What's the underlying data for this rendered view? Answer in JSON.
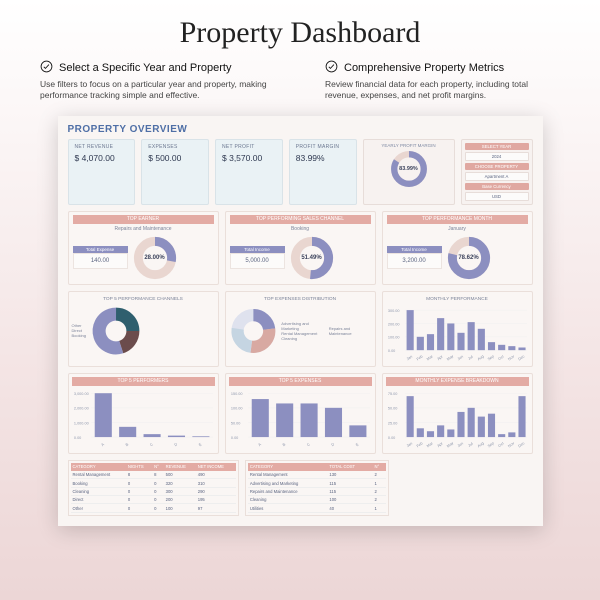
{
  "page": {
    "title": "Property Dashboard"
  },
  "features": [
    {
      "title": "Select a Specific Year and Property",
      "body": "Use filters to focus on a particular year and property, making performance tracking simple and effective."
    },
    {
      "title": "Comprehensive Property Metrics",
      "body": "Review financial data for each property, including total revenue, expenses, and net profit margins."
    }
  ],
  "dash": {
    "title": "PROPERTY OVERVIEW",
    "kpi": {
      "net_revenue": {
        "label": "NET REVENUE",
        "value": "$ 4,070.00"
      },
      "expenses": {
        "label": "EXPENSES",
        "value": "$ 500.00"
      },
      "net_profit": {
        "label": "NET PROFIT",
        "value": "$ 3,570.00"
      },
      "margin": {
        "label": "PROFIT MARGIN",
        "value": "83.99%"
      }
    },
    "gauge": {
      "header": "YEARLY PROFIT MARGIN",
      "pct": 83.99,
      "pct_text": "83.99%"
    },
    "filters": {
      "year": {
        "label": "SELECT YEAR",
        "value": "2024"
      },
      "property": {
        "label": "CHOOSE PROPERTY",
        "value": "Apartment A"
      },
      "currency": {
        "label": "Base Currency",
        "value": "USD"
      }
    },
    "highlight": {
      "top_earner": {
        "band": "TOP EARNER",
        "sub": "Repairs and Maintenance",
        "stat_label": "Total Expense",
        "stat_value": "140.00",
        "pct": 28.0,
        "pct_text": "28.00%"
      },
      "top_channel": {
        "band": "TOP PERFORMING SALES CHANNEL",
        "sub": "Booking",
        "stat_label": "Total Income",
        "stat_value": "5,000.00",
        "pct": 51.49,
        "pct_text": "51.49%"
      },
      "top_month": {
        "band": "TOP PERFORMANCE MONTH",
        "sub": "January",
        "stat_label": "Total Income",
        "stat_value": "3,200.00",
        "pct": 78.62,
        "pct_text": "78.62%"
      }
    },
    "labels": {
      "top5ch": "TOP 5 PERFORMANCE CHANNELS",
      "topexp": "TOP EXPENSES DISTRIBUTION",
      "monperf": "MONTHLY PERFORMANCE",
      "top5perf": "TOP 5 PERFORMERS",
      "top5exp": "TOP 5 EXPENSES",
      "monexp": "MONTHLY EXPENSE BREAKDOWN",
      "table1": [
        "CATEGORY",
        "NIGHTS",
        "N°",
        "REVENUE",
        "NET INCOME"
      ],
      "table2": [
        "CATEGORY",
        "TOTAL COST",
        "N°"
      ]
    }
  },
  "chart_data": [
    {
      "id": "yearly_gauge",
      "type": "pie",
      "title": "YEARLY PROFIT MARGIN",
      "values": [
        83.99,
        16.01
      ],
      "labels": [
        "Profit",
        "Remainder"
      ]
    },
    {
      "id": "top_earner",
      "type": "pie",
      "title": "TOP EARNER — Repairs and Maintenance",
      "values": [
        28.0,
        72.0
      ]
    },
    {
      "id": "top_channel",
      "type": "pie",
      "title": "TOP PERFORMING SALES CHANNEL — Booking",
      "values": [
        51.49,
        48.51
      ]
    },
    {
      "id": "top_month",
      "type": "pie",
      "title": "TOP PERFORMANCE MONTH — January",
      "values": [
        78.62,
        21.38
      ]
    },
    {
      "id": "top5_channels_donut",
      "type": "pie",
      "title": "TOP 5 PERFORMANCE CHANNELS",
      "labels": [
        "Other",
        "Direct",
        "Booking"
      ],
      "values": [
        25,
        20,
        55
      ]
    },
    {
      "id": "top_expenses_donut",
      "type": "pie",
      "title": "TOP EXPENSES DISTRIBUTION",
      "labels": [
        "Advertising and Marketing",
        "Repairs and Maintenance",
        "Rental Management",
        "Cleaning"
      ],
      "values": [
        23,
        29,
        25,
        23
      ]
    },
    {
      "id": "monthly_perf_bar",
      "type": "bar",
      "title": "MONTHLY PERFORMANCE",
      "categories": [
        "Jan",
        "Feb",
        "Mar",
        "Apr",
        "May",
        "Jun",
        "Jul",
        "Aug",
        "Sep",
        "Oct",
        "Nov",
        "Dec"
      ],
      "values": [
        300,
        100,
        120,
        240,
        200,
        130,
        210,
        160,
        60,
        40,
        30,
        20
      ],
      "ylim": [
        0,
        300
      ],
      "ylabel": "",
      "xlabel": ""
    },
    {
      "id": "top5_performers_bar",
      "type": "bar",
      "title": "TOP 5 PERFORMERS",
      "categories": [
        "A",
        "B",
        "C",
        "D",
        "E"
      ],
      "values": [
        3000,
        700,
        200,
        100,
        50
      ],
      "ylim": [
        0,
        3000
      ]
    },
    {
      "id": "top5_expenses_bar",
      "type": "bar",
      "title": "TOP 5 EXPENSES",
      "categories": [
        "A",
        "B",
        "C",
        "D",
        "E"
      ],
      "values": [
        130,
        115,
        115,
        100,
        40
      ],
      "ylim": [
        0,
        150
      ]
    },
    {
      "id": "monthly_expense_bar",
      "type": "bar",
      "title": "MONTHLY EXPENSE BREAKDOWN",
      "categories": [
        "Jan",
        "Feb",
        "Mar",
        "Apr",
        "May",
        "Jun",
        "Jul",
        "Aug",
        "Sep",
        "Oct",
        "Nov",
        "Dec"
      ],
      "values": [
        70,
        15,
        10,
        20,
        13,
        43,
        50,
        35,
        40,
        5,
        8,
        70
      ],
      "ylim": [
        0,
        75
      ]
    },
    {
      "id": "table_performers",
      "type": "table",
      "title": "Performers",
      "columns": [
        "CATEGORY",
        "NIGHTS",
        "N°",
        "REVENUE",
        "NET INCOME"
      ],
      "rows": [
        [
          "Rental Management",
          "8",
          "8",
          "500",
          "490"
        ],
        [
          "Booking",
          "0",
          "0",
          "320",
          "310"
        ],
        [
          "Cleaning",
          "0",
          "0",
          "300",
          "290"
        ],
        [
          "Direct",
          "0",
          "0",
          "200",
          "195"
        ],
        [
          "Other",
          "0",
          "0",
          "100",
          "97"
        ]
      ]
    },
    {
      "id": "table_expenses",
      "type": "table",
      "title": "Expenses",
      "columns": [
        "CATEGORY",
        "TOTAL COST",
        "N°"
      ],
      "rows": [
        [
          "Rental Management",
          "130",
          "2"
        ],
        [
          "Advertising and Marketing",
          "115",
          "1"
        ],
        [
          "Repairs and Maintenance",
          "115",
          "2"
        ],
        [
          "Cleaning",
          "100",
          "2"
        ],
        [
          "Utilities",
          "40",
          "1"
        ]
      ]
    }
  ]
}
